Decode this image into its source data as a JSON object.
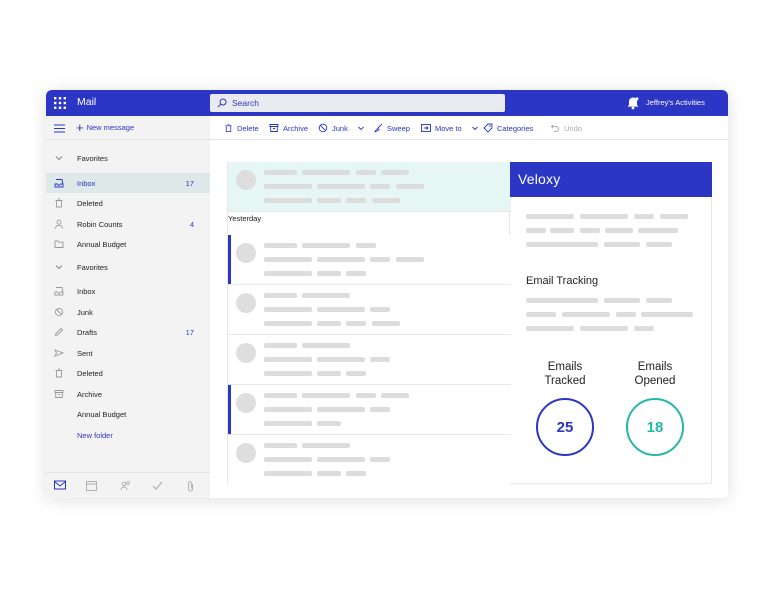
{
  "app": {
    "title": "Mail"
  },
  "search": {
    "placeholder": "Search"
  },
  "header": {
    "activities": "Jeffrey's Activities"
  },
  "sidebar": {
    "new_message": "New message",
    "items": [
      {
        "label": "Favorites",
        "count": "",
        "icon": "chevron-down-icon"
      },
      {
        "label": "Inbox",
        "count": "17",
        "icon": "inbox-icon"
      },
      {
        "label": "Deleted",
        "count": "",
        "icon": "trash-icon"
      },
      {
        "label": "Robin Counts",
        "count": "4",
        "icon": "person-icon"
      },
      {
        "label": "Annual Budget",
        "count": "",
        "icon": "folder-icon"
      },
      {
        "label": "Favorites",
        "count": "",
        "icon": "chevron-down-icon"
      },
      {
        "label": "Inbox",
        "count": "",
        "icon": "inbox-icon"
      },
      {
        "label": "Junk",
        "count": "",
        "icon": "junk-icon"
      },
      {
        "label": "Drafts",
        "count": "17",
        "icon": "pencil-icon"
      },
      {
        "label": "Sent",
        "count": "",
        "icon": "send-icon"
      },
      {
        "label": "Deleted",
        "count": "",
        "icon": "trash-icon"
      },
      {
        "label": "Archive",
        "count": "",
        "icon": "archive-icon"
      },
      {
        "label": "Annual Budget",
        "count": "",
        "icon": ""
      },
      {
        "label": "New folder",
        "count": "",
        "icon": ""
      }
    ]
  },
  "toolbar": {
    "delete": "Delete",
    "archive": "Archive",
    "junk": "Junk",
    "sweep": "Sweep",
    "move_to": "Move to",
    "categories": "Categories",
    "undo": "Undo"
  },
  "list": {
    "group_label": "Yesterday"
  },
  "panel": {
    "brand": "Veloxy",
    "section_title": "Email Tracking",
    "stats": [
      {
        "label_line1": "Emails",
        "label_line2": "Tracked",
        "value": "25",
        "color": "#2b36c4"
      },
      {
        "label_line1": "Emails",
        "label_line2": "Opened",
        "value": "18",
        "color": "#22b8a8"
      }
    ]
  },
  "colors": {
    "accent": "#2b36c4",
    "teal": "#22b8a8",
    "selection": "#dde8e8",
    "highlight_row": "#e5f6f5"
  }
}
